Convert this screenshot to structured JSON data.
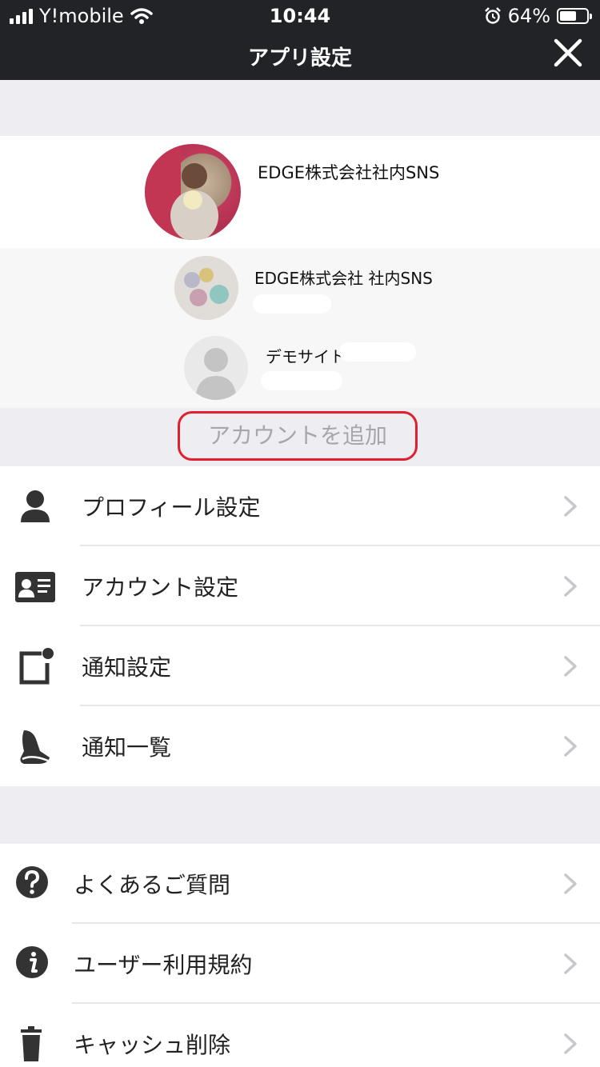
{
  "status_bar": {
    "carrier": "Y!mobile",
    "time": "10:44",
    "battery_percent": "64%",
    "battery_level": 0.64
  },
  "nav": {
    "title": "アプリ設定",
    "close_icon": "close-icon"
  },
  "accounts": {
    "current": {
      "name": "EDGE株式会社社内SNS"
    },
    "others": [
      {
        "name": "EDGE株式会社 社内SNS"
      },
      {
        "name": "デモサイト"
      }
    ],
    "add_label": "アカウントを追加"
  },
  "menu_main": [
    {
      "label": "プロフィール設定",
      "icon": "person-icon"
    },
    {
      "label": "アカウント設定",
      "icon": "id-card-icon"
    },
    {
      "label": "通知設定",
      "icon": "notification-badge-icon"
    },
    {
      "label": "通知一覧",
      "icon": "bell-icon"
    }
  ],
  "menu_support": [
    {
      "label": "よくあるご質問",
      "icon": "question-icon"
    },
    {
      "label": "ユーザー利用規約",
      "icon": "info-icon"
    },
    {
      "label": "キャッシュ削除",
      "icon": "trash-icon"
    }
  ],
  "colors": {
    "header_bg": "#222326",
    "section_gray": "#eeeef2",
    "add_border": "#e0202e",
    "add_text": "#a7a7ab",
    "chevron": "#c7c7cc",
    "icon": "#333333"
  }
}
